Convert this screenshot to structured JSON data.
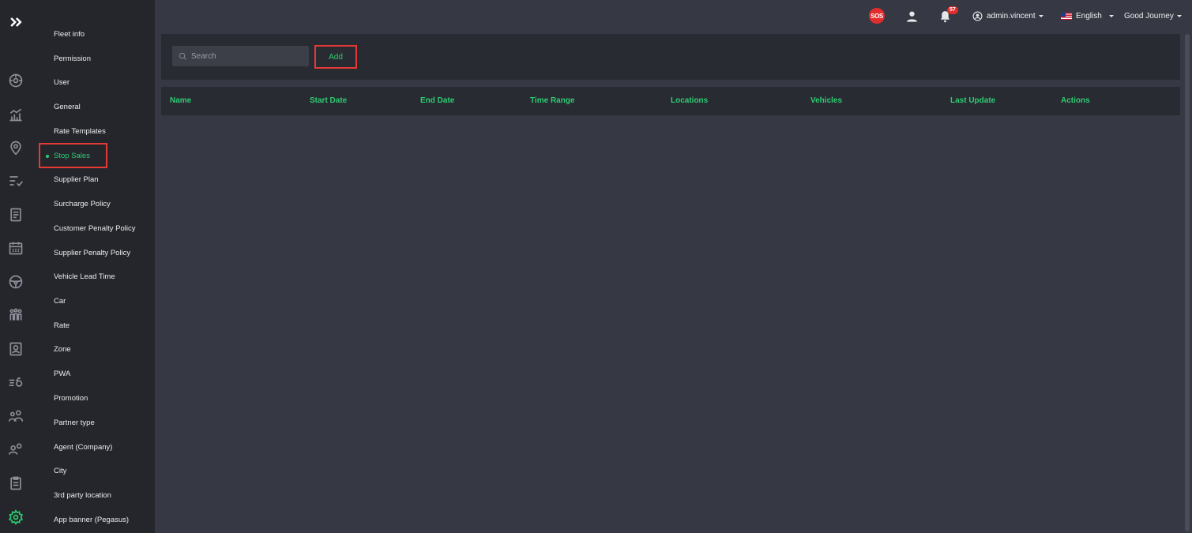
{
  "rail": {
    "icons": [
      "expand-icon",
      "dashboard-icon",
      "chart-icon",
      "location-pin-icon",
      "checklist-icon",
      "document-icon",
      "calendar-icon",
      "steering-wheel-icon",
      "people-group-icon",
      "contact-card-icon",
      "speed-icon",
      "team-icon",
      "user-manage-icon",
      "clipboard-icon",
      "settings-gear-icon"
    ],
    "active": "settings-gear-icon"
  },
  "submenu": {
    "items": [
      "Fleet info",
      "Permission",
      "User",
      "General",
      "Rate Templates",
      "Stop Sales",
      "Supplier Plan",
      "Surcharge Policy",
      "Customer Penalty Policy",
      "Supplier Penalty Policy",
      "Vehicle Lead Time",
      "Car",
      "Rate",
      "Zone",
      "PWA",
      "Promotion",
      "Partner type",
      "Agent (Company)",
      "City",
      "3rd party location",
      "App banner (Pegasus)"
    ],
    "active": "Stop Sales"
  },
  "topbar": {
    "sos_label": "SOS",
    "notification_count": "57",
    "username": "admin.vincent",
    "language": "English",
    "company": "Good Journey"
  },
  "toolbar": {
    "search_placeholder": "Search",
    "add_label": "Add"
  },
  "table": {
    "columns": [
      "Name",
      "Start Date",
      "End Date",
      "Time Range",
      "Locations",
      "Vehicles",
      "Last Update",
      "Actions"
    ]
  },
  "colors": {
    "accent": "#2ecc71",
    "highlight": "#e53935",
    "sidebar_bg": "#24262c",
    "content_bg": "#363944",
    "panel_bg": "#282b32"
  }
}
